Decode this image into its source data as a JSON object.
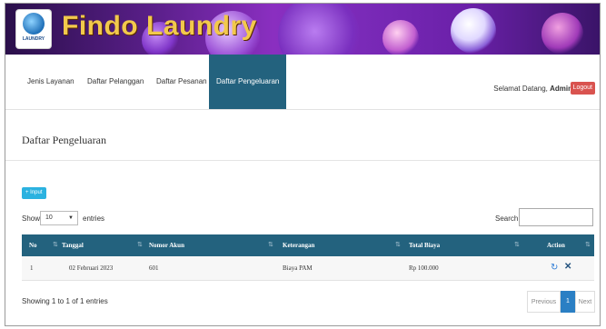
{
  "brand": {
    "logo_text": "LAUNDRY",
    "title": "Findo Laundry"
  },
  "nav": {
    "items": [
      {
        "label": "Jenis Layanan"
      },
      {
        "label": "Daftar Pelanggan"
      },
      {
        "label": "Daftar Pesanan"
      },
      {
        "label": "Daftar Pengeluaran"
      }
    ],
    "active_index": 3,
    "welcome_prefix": "Selamat Datang, ",
    "user": "Admin",
    "logout_label": "Logout"
  },
  "page": {
    "title": "Daftar Pengeluaran",
    "input_button": "+ Input",
    "show_label": "Show",
    "entries_value": "10",
    "entries_label": "entries",
    "search_label": "Search"
  },
  "table": {
    "headers": [
      "No",
      "Tanggal",
      "Nomor Akun",
      "Keterangan",
      "Total Biaya",
      "Action"
    ],
    "rows": [
      {
        "no": "1",
        "tanggal": "02 Februari 2023",
        "akun": "601",
        "keterangan": "Biaya PAM",
        "total": "Rp 100.000"
      }
    ]
  },
  "footer": {
    "info": "Showing 1 to 1 of 1 entries",
    "prev": "Previous",
    "page": "1",
    "next": "Next"
  },
  "colors": {
    "nav_active": "#23627e",
    "header_row": "#23627e",
    "logout": "#d9534f",
    "input_button": "#2bb2e0",
    "page_active": "#2a7fc4",
    "title_gold": "#f2c94c"
  },
  "icons": {
    "edit": "edit-icon",
    "delete": "close-icon"
  }
}
